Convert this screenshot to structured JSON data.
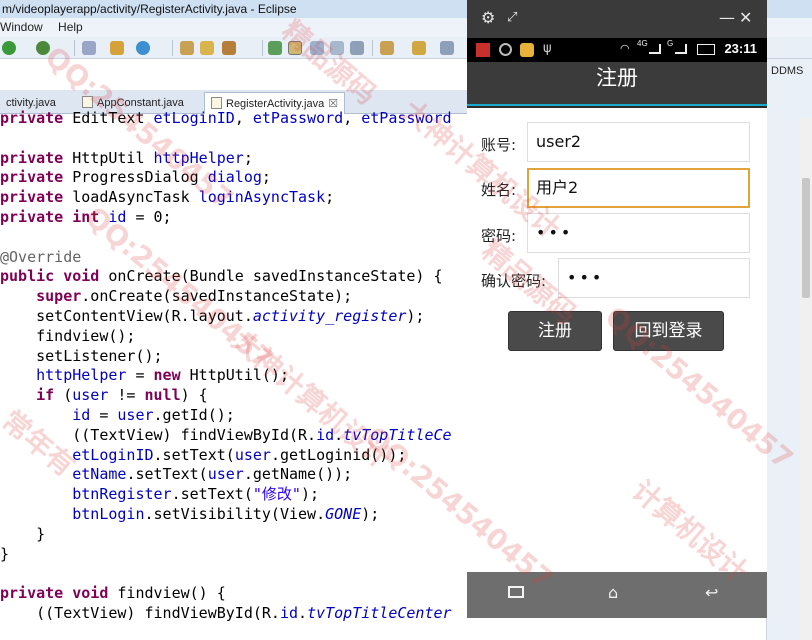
{
  "eclipse": {
    "title": "m/videoplayerapp/activity/RegisterActivity.java - Eclipse",
    "menu": [
      "Window",
      "Help"
    ],
    "tabs": [
      {
        "label": "ctivity.java"
      },
      {
        "label": "AppConstant.java"
      },
      {
        "label": "RegisterActivity.java",
        "close": "☒"
      }
    ],
    "right_panel_label": "DDMS"
  },
  "code_lines": [
    "private EditText etLoginID, etPassword, etPassword",
    "",
    "private HttpUtil httpHelper;",
    "private ProgressDialog dialog;",
    "private loadAsyncTask loginAsyncTask;",
    "private int id = 0;",
    "",
    "@Override",
    "public void onCreate(Bundle savedInstanceState) {",
    "    super.onCreate(savedInstanceState);",
    "    setContentView(R.layout.activity_register);",
    "    findview();",
    "    setListener();",
    "    httpHelper = new HttpUtil();",
    "    if (user != null) {",
    "        id = user.getId();",
    "        ((TextView) findViewById(R.id.tvTopTitleCe",
    "        etLoginID.setText(user.getLoginid());",
    "        etName.setText(user.getName());",
    "        btnRegister.setText(\"修改\");",
    "        btnLogin.setVisibility(View.GONE);",
    "    }",
    "}",
    "",
    "private void findview() {",
    "    ((TextView) findViewById(R.id.tvTopTitleCenter"
  ],
  "emulator": {
    "status_time": "23:11",
    "status_network": "4G",
    "status_network2": "G",
    "app_title": "注册",
    "form": {
      "account_label": "账号:",
      "account_value": "user2",
      "name_label": "姓名:",
      "name_value": "用户2",
      "password_label": "密码:",
      "password_value": "•••",
      "confirm_label": "确认密码:",
      "confirm_value": "•••"
    },
    "buttons": {
      "register": "注册",
      "back_to_login": "回到登录"
    }
  },
  "watermark": [
    "QQ:254540457",
    "精品源码",
    "大神计算机设计",
    "QQ:254540457",
    "精品源码",
    "大神计算机设计",
    "QQ:254540457",
    "常年有",
    "QQ:254540457",
    "计算机设计"
  ],
  "colors": {
    "keyword": "#7f0055",
    "field": "#0000c0",
    "string": "#2a00ff",
    "focus_border": "#e2a33a",
    "app_bar": "#3b3b3b",
    "accent_line": "#16a9c9"
  }
}
